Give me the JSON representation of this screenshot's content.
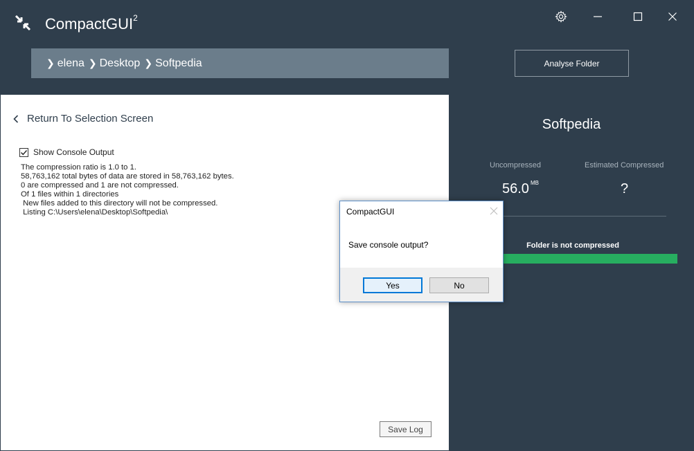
{
  "window": {
    "title": "CompactGUI",
    "title_sup": "2"
  },
  "breadcrumb": [
    "elena",
    "Desktop",
    "Softpedia"
  ],
  "header": {
    "analyse_label": "Analyse Folder"
  },
  "left": {
    "return_label": "Return To Selection Screen",
    "console_checkbox_label": "Show Console Output",
    "console_checked": true,
    "console_lines": [
      "The compression ratio is 1.0 to 1.",
      "58,763,162 total bytes of data are stored in 58,763,162 bytes.",
      "0 are compressed and 1 are not compressed.",
      "Of 1 files within 1 directories",
      " New files added to this directory will not be compressed.",
      " Listing C:\\Users\\elena\\Desktop\\Softpedia\\"
    ],
    "save_log_label": "Save Log"
  },
  "right": {
    "folder_name": "Softpedia",
    "uncompressed_label": "Uncompressed",
    "estimated_label": "Estimated Compressed",
    "uncompressed_value": "56.0",
    "uncompressed_unit": "MB",
    "estimated_value": "?",
    "status_text": "Folder is not compressed",
    "status_color": "#27ae60"
  },
  "dialog": {
    "title": "CompactGUI",
    "message": "Save console output?",
    "yes_label": "Yes",
    "no_label": "No"
  },
  "colors": {
    "header_bg": "#2f3e4c",
    "breadcrumb_bg": "#6b7d8b",
    "accent_green": "#27ae60",
    "dialog_focus": "#0078d7"
  },
  "icons": {
    "app": "compress-arrows-icon",
    "settings": "gear-icon",
    "minimize": "minimize-icon",
    "maximize": "maximize-icon",
    "close": "close-icon",
    "breadcrumb_sep": "chevron-right-icon",
    "back": "chevron-left-icon",
    "check": "checkmark-icon"
  }
}
